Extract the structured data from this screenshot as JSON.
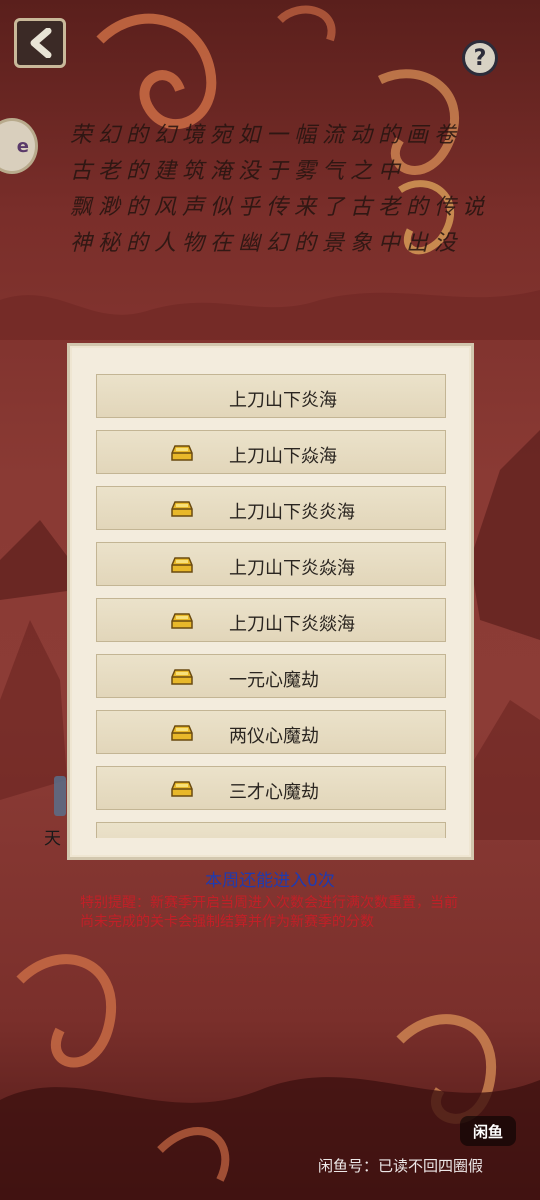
{
  "poem": {
    "lines": [
      "荣幻的幻境宛如一幅流动的画卷",
      "古老的建筑淹没于雾气之中",
      "飘渺的风声似乎传来了古老的传说",
      "神秘的人物在幽幻的景象中出没"
    ]
  },
  "header": {
    "back_icon": "back-arrow-icon",
    "help_label": "?",
    "side_tab_label": "e"
  },
  "levels": {
    "items": [
      {
        "label": "上刀山下炎海",
        "locked": false
      },
      {
        "label": "上刀山下焱海",
        "locked": true
      },
      {
        "label": "上刀山下炎炎海",
        "locked": true
      },
      {
        "label": "上刀山下炎焱海",
        "locked": true
      },
      {
        "label": "上刀山下炎燚海",
        "locked": true
      },
      {
        "label": "一元心魔劫",
        "locked": true
      },
      {
        "label": "两仪心魔劫",
        "locked": true
      },
      {
        "label": "三才心魔劫",
        "locked": true
      }
    ],
    "lock_icon": "gold-ingot-icon"
  },
  "status": {
    "weekly_entries": "本周还能进入0次",
    "notice": "特别提醒：新赛季开启当周进入次数会进行满次数重置，当前尚未完成的关卡会强制结算并作为新赛季的分数"
  },
  "side": {
    "char": "天"
  },
  "watermark": {
    "logo": "闲鱼",
    "text": "闲鱼号：已读不回四圈假"
  },
  "colors": {
    "background": "#8a3a34",
    "panel": "#f3ecdd",
    "button": "#e6dcc2",
    "count_text": "#1f3bb0",
    "notice_text": "#c21f27"
  }
}
